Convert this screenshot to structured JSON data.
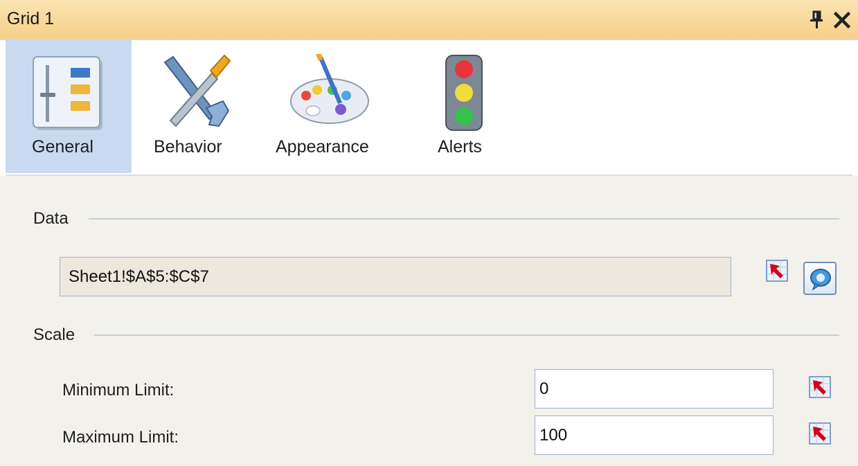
{
  "window": {
    "title": "Grid 1"
  },
  "tabs": [
    {
      "label": "General",
      "icon": "general-settings-icon",
      "selected": true
    },
    {
      "label": "Behavior",
      "icon": "wrench-screwdriver-icon",
      "selected": false
    },
    {
      "label": "Appearance",
      "icon": "paint-palette-icon",
      "selected": false
    },
    {
      "label": "Alerts",
      "icon": "traffic-light-icon",
      "selected": false
    }
  ],
  "data_section": {
    "label": "Data",
    "range_value": "Sheet1!$A$5:$C$7"
  },
  "scale_section": {
    "label": "Scale",
    "min_label": "Minimum Limit:",
    "min_value": "0",
    "max_label": "Maximum Limit:",
    "max_value": "100"
  },
  "colors": {
    "title_bar": "#f5cf86",
    "selected_tab": "#c9d9f0",
    "panel_background": "#f3f1ec",
    "field_border": "#9db1cf"
  }
}
